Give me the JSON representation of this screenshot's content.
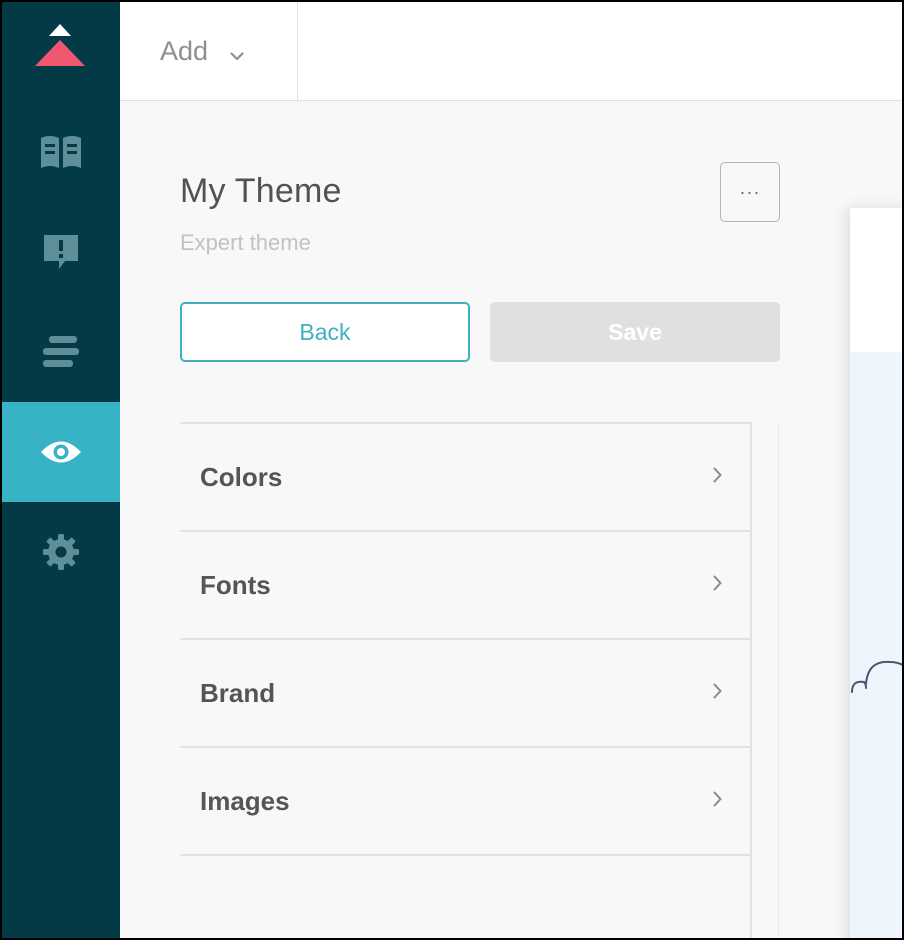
{
  "toolbar": {
    "add_label": "Add"
  },
  "theme": {
    "title": "My Theme",
    "subtitle": "Expert theme",
    "more_label": "···"
  },
  "actions": {
    "back_label": "Back",
    "save_label": "Save"
  },
  "menu": [
    {
      "label": "Colors"
    },
    {
      "label": "Fonts"
    },
    {
      "label": "Brand"
    },
    {
      "label": "Images"
    }
  ],
  "sidebar": {
    "items": [
      {
        "icon": "book-icon",
        "active": false
      },
      {
        "icon": "alert-icon",
        "active": false
      },
      {
        "icon": "list-icon",
        "active": false
      },
      {
        "icon": "eye-icon",
        "active": true
      },
      {
        "icon": "gear-icon",
        "active": false
      }
    ]
  },
  "colors": {
    "sidebar_bg": "#033a45",
    "accent": "#37b3c5",
    "logo": "#f0576e",
    "icon": "#5e8f98"
  }
}
